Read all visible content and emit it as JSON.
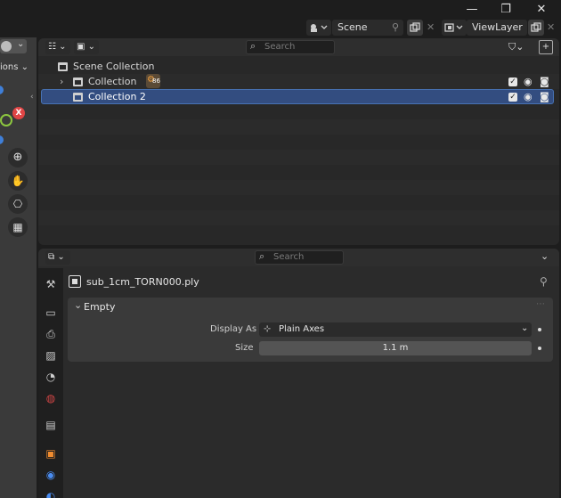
{
  "window": {
    "minimize_glyph": "—",
    "maximize_glyph": "❐",
    "close_glyph": "✕"
  },
  "topbar": {
    "scene_label": "Scene",
    "viewlayer_label": "ViewLayer"
  },
  "viewport_edge": {
    "options_label": "ions",
    "x_axis_label": "X"
  },
  "outliner": {
    "search_placeholder": "Search",
    "items": [
      {
        "label": "Scene Collection",
        "level": 0,
        "selected": false
      },
      {
        "label": "Collection",
        "level": 1,
        "selected": false,
        "badge": "86"
      },
      {
        "label": "Collection 2",
        "level": 1,
        "selected": true
      }
    ]
  },
  "properties": {
    "search_placeholder": "Search",
    "object_name": "sub_1cm_TORN000.ply",
    "panel_title": "Empty",
    "fields": [
      {
        "label": "Display As",
        "value": "Plain Axes"
      },
      {
        "label": "Size",
        "value": "1.1 m"
      }
    ]
  },
  "colors": {
    "selection": "#334d80",
    "selection_border": "#4772b3",
    "background": "#1d1d1d",
    "panel": "#2b2b2b"
  },
  "icons": [
    "minimize-icon",
    "maximize-icon",
    "close-icon",
    "scene-icon",
    "pin-icon",
    "copy-icon",
    "viewlayer-icon",
    "filter-icon",
    "new-collection-icon",
    "search-icon",
    "collection-icon",
    "checkbox-icon",
    "eye-icon",
    "camera-icon",
    "tool-icon",
    "render-icon",
    "output-icon",
    "view-layer-icon",
    "scene-props-icon",
    "world-icon",
    "collection-props-icon",
    "object-icon",
    "modifier-icon",
    "physics-icon",
    "zoom-icon",
    "hand-icon",
    "camera-view-icon",
    "grid-icon"
  ]
}
